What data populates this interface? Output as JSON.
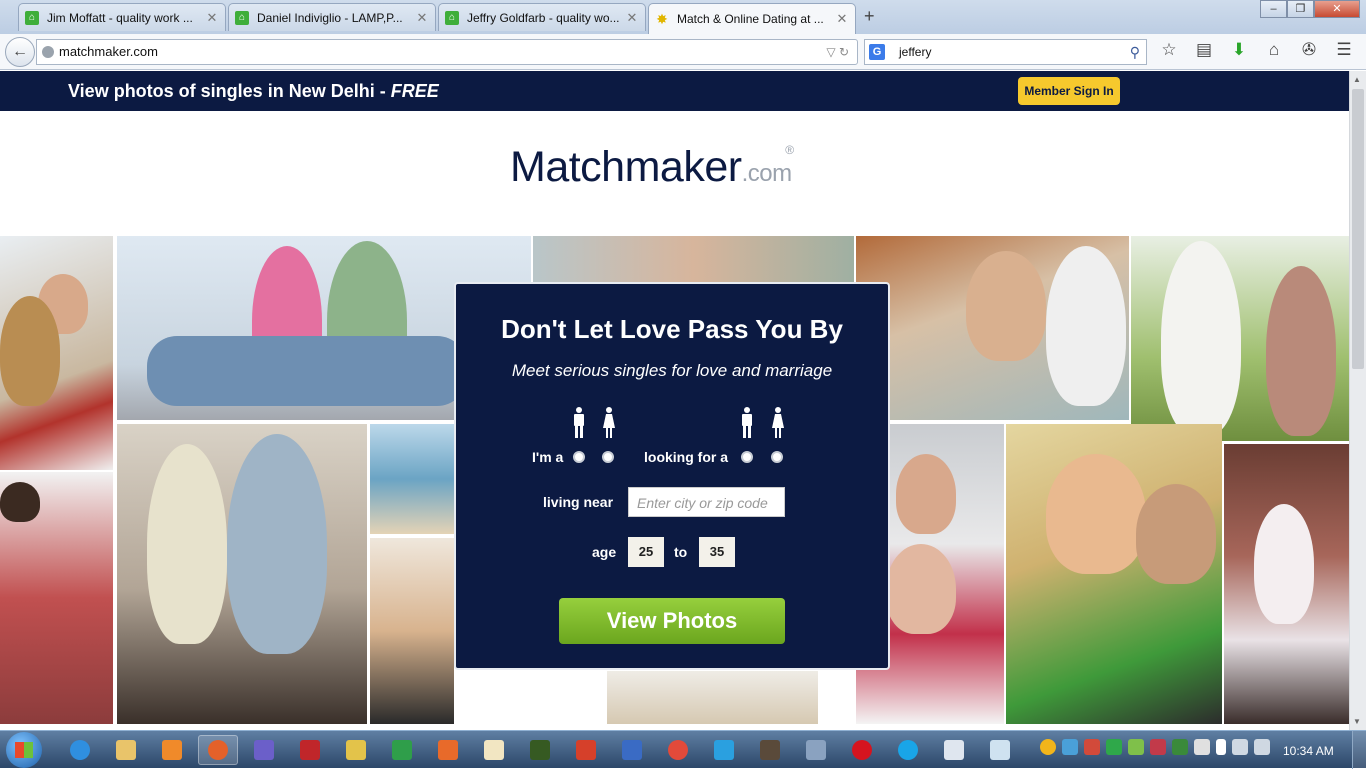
{
  "browser": {
    "tabs": [
      {
        "title": "Jim Moffatt - quality work ...",
        "icon": "upwork-icon"
      },
      {
        "title": "Daniel Indiviglio - LAMP,P...",
        "icon": "upwork-icon"
      },
      {
        "title": "Jeffry Goldfarb - quality wo...",
        "icon": "upwork-icon"
      },
      {
        "title": "Match & Online Dating at ...",
        "icon": "match-icon"
      }
    ],
    "url": "matchmaker.com",
    "search_value": "jeffery",
    "search_engine": "G"
  },
  "page": {
    "promo_text": "View photos of singles in New Delhi - ",
    "promo_emphasis": "FREE",
    "signin_label": "Member Sign In",
    "logo_main": "Matchmaker",
    "logo_suffix": ".com",
    "logo_reg": "®",
    "form": {
      "headline": "Don't Let Love Pass You By",
      "subheadline": "Meet serious singles for love and marriage",
      "im_a_label": "I'm a",
      "looking_for_label": "looking for a",
      "living_near_label": "living near",
      "city_placeholder": "Enter city or zip code",
      "age_label": "age",
      "age_min": "25",
      "age_to_label": "to",
      "age_max": "35",
      "submit_label": "View Photos"
    }
  },
  "taskbar": {
    "clock": "10:34 AM"
  },
  "colors": {
    "navy": "#0c1a42",
    "accent_yellow": "#f6c92d",
    "button_green": "#7fbc2a"
  }
}
